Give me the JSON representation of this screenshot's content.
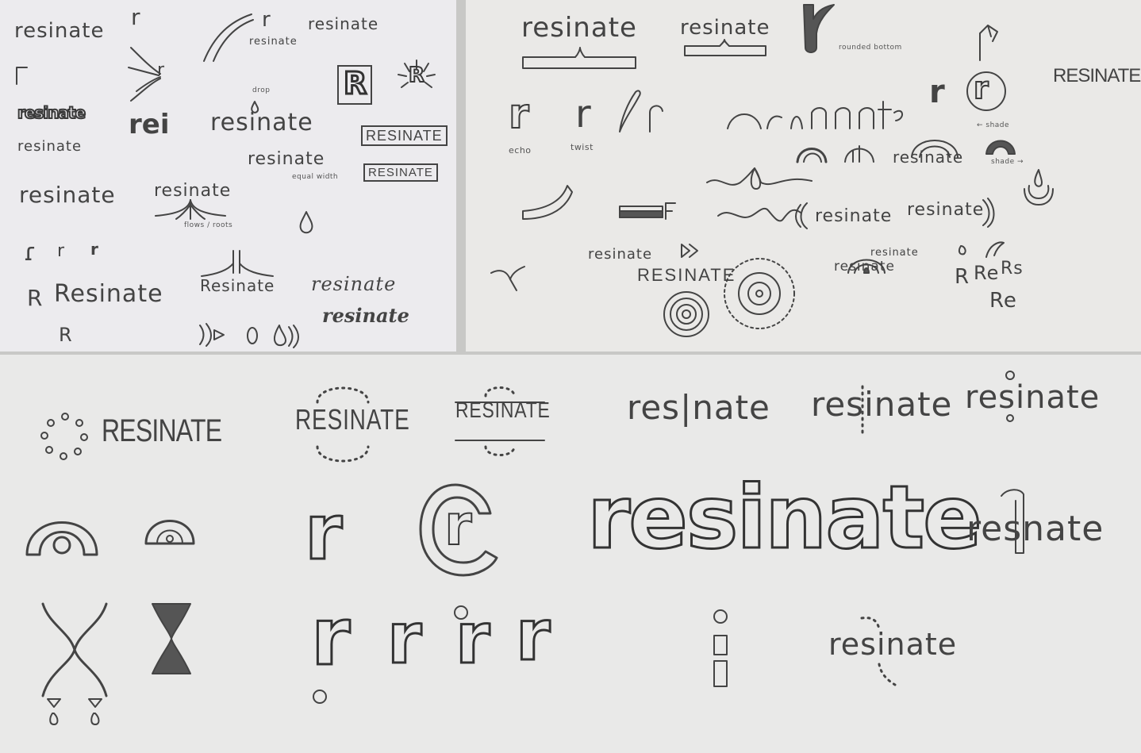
{
  "panel_a": {
    "words": {
      "w1": "resinate",
      "w2": "resinate",
      "w3": "resinate",
      "w4": "resinate",
      "w5": "resinate",
      "w6": "resinate",
      "w7": "resinate",
      "w8": "resinate",
      "w9": "resinate",
      "w10": "Resinate",
      "w11": "Resinate",
      "w12": "resinate",
      "rei": "rei",
      "boxed_upper1": "RESINATE",
      "boxed_upper2": "RESINATE",
      "letter_r1": "r",
      "letter_r2": "r",
      "letter_R": "R",
      "letter_R2": "R",
      "big_R": "R",
      "leaf_R": "R",
      "bracket_r": "r",
      "squiggle": "ɾ"
    },
    "notes": {
      "drop": "drop",
      "equal_width": "equal width",
      "flows_roots": "flows / roots"
    }
  },
  "panel_b": {
    "words": {
      "w1": "resinate",
      "w2": "resinate",
      "w3": "resinate",
      "w4": "resinate",
      "w5": "resinate",
      "w6": "resinate",
      "w7": "resinate",
      "upper1": "RESINATE",
      "upper2": "RESINATE",
      "arch_word": "resinate",
      "r1": "r",
      "r2": "r",
      "r_echo": "r",
      "r_twist": "r",
      "r3": "r",
      "r4": "r",
      "R1": "R",
      "Re1": "Re",
      "Rs1": "Rs",
      "Re2": "Re"
    },
    "notes": {
      "rounded_bottom": "rounded bottom",
      "echo": "echo",
      "twist": "twist",
      "shade1": "← shade",
      "shade2": "shade →"
    }
  },
  "panel_c": {
    "words": {
      "upper1": "RESINATE",
      "upper2": "RESINATE",
      "upper3": "RESINATE",
      "w1": "res|nate",
      "w2": "resinate",
      "w3": "resinate",
      "big_outline": "resinate",
      "w4": "resnate",
      "w5": "resinate",
      "r_outline": "r",
      "r_c": "r",
      "r_a": "r",
      "r_b": "r",
      "r_c2": "r",
      "r_d": "r",
      "i_outline": "i"
    }
  }
}
